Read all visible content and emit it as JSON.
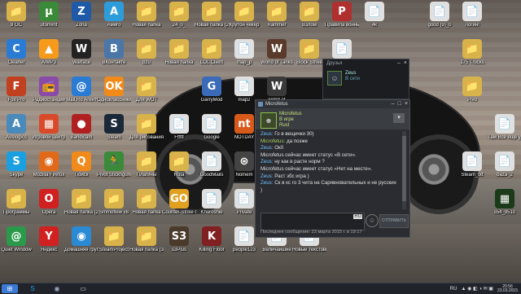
{
  "desktop_icons": [
    {
      "label": "8 ОС",
      "glyph": "📁",
      "color": "#d8b24a",
      "pos": "0,0"
    },
    {
      "label": "utorrent",
      "glyph": "µ",
      "color": "#3a8a3a",
      "pos": "1,0"
    },
    {
      "label": "Zona",
      "glyph": "Z",
      "color": "#1e5aa8",
      "pos": "2,0"
    },
    {
      "label": "Амиго",
      "glyph": "A",
      "color": "#2d9cdb",
      "pos": "3,0"
    },
    {
      "label": "Новая папка",
      "glyph": "📁",
      "color": "#d8b24a",
      "pos": "4,0"
    },
    {
      "label": "24_0_",
      "glyph": "📁",
      "color": "#d8b24a",
      "pos": "5,0"
    },
    {
      "label": "Новая папка (2)",
      "glyph": "📁",
      "color": "#d8b24a",
      "pos": "6,0"
    },
    {
      "label": "Крутой чекер",
      "glyph": "📁",
      "color": "#d8b24a",
      "pos": "7,0"
    },
    {
      "label": "Rammer",
      "glyph": "📁",
      "color": "#d8b24a",
      "pos": "8,0"
    },
    {
      "label": "Взлом",
      "glyph": "📁",
      "color": "#d8b24a",
      "pos": "9,0"
    },
    {
      "label": "Правила войны",
      "glyph": "P",
      "color": "#b03030",
      "pos": "10,0"
    },
    {
      "label": "4k",
      "glyph": "📄",
      "color": "#e0e0e0",
      "pos": "11,0"
    },
    {
      "label": "good (9)_0",
      "glyph": "📄",
      "color": "#e0e0e0",
      "pos": "13,0"
    },
    {
      "label": "Логин!",
      "glyph": "📄",
      "color": "#e0e0e0",
      "pos": "14,0"
    },
    {
      "label": "Cleaner",
      "glyph": "C",
      "color": "#2a7bd4",
      "pos": "0,1"
    },
    {
      "label": "AIMP3",
      "glyph": "▲",
      "color": "#f59a1a",
      "pos": "1,1"
    },
    {
      "label": "Warface",
      "glyph": "W",
      "color": "#222222",
      "pos": "2,1"
    },
    {
      "label": "ВКонтакте",
      "glyph": "В",
      "color": "#4a76a8",
      "pos": "3,1"
    },
    {
      "label": "bzu",
      "glyph": "📁",
      "color": "#d8b24a",
      "pos": "4,1"
    },
    {
      "label": "Новая папка",
      "glyph": "📁",
      "color": "#d8b24a",
      "pos": "5,1"
    },
    {
      "label": "LOL Client",
      "glyph": "📁",
      "color": "#d8b24a",
      "pos": "6,1"
    },
    {
      "label": "map_p",
      "glyph": "📄",
      "color": "#e0e0e0",
      "pos": "7,1"
    },
    {
      "label": "World of Tanks",
      "glyph": "W",
      "color": "#5a3a2a",
      "pos": "8,1"
    },
    {
      "label": "Block Strike",
      "glyph": "📁",
      "color": "#d8b24a",
      "pos": "9,1"
    },
    {
      "label": "good 24",
      "glyph": "📄",
      "color": "#e0e0e0",
      "pos": "10,1"
    },
    {
      "label": "175 Trucks",
      "glyph": "📁",
      "color": "#d8b24a",
      "pos": "14,1"
    },
    {
      "label": "Fox Pro",
      "glyph": "F",
      "color": "#c04020",
      "pos": "0,2"
    },
    {
      "label": "Радиостанции",
      "glyph": "📻",
      "color": "#8a4aa8",
      "pos": "1,2"
    },
    {
      "label": "Mail.Ru Агент",
      "glyph": "@",
      "color": "#2a7bd4",
      "pos": "2,2"
    },
    {
      "label": "Одноклассники",
      "glyph": "OK",
      "color": "#f28a1a",
      "pos": "3,2"
    },
    {
      "label": "Для WOT",
      "glyph": "📁",
      "color": "#d8b24a",
      "pos": "4,2"
    },
    {
      "label": "GarryMod",
      "glyph": "G",
      "color": "#3a6ab8",
      "pos": "6,2"
    },
    {
      "label": "map2",
      "glyph": "📄",
      "color": "#e0e0e0",
      "pos": "7,2"
    },
    {
      "label": "world of",
      "glyph": "W",
      "color": "#3a3a3a",
      "pos": "8,2"
    },
    {
      "label": "Pivo",
      "glyph": "📁",
      "color": "#d8b24a",
      "pos": "14,2"
    },
    {
      "label": "Auslogics",
      "glyph": "A",
      "color": "#4a8aba",
      "pos": "0,3"
    },
    {
      "label": "Игровой центр",
      "glyph": "▦",
      "color": "#d84a2a",
      "pos": "1,3"
    },
    {
      "label": "Bandicam",
      "glyph": "●",
      "color": "#b02020",
      "pos": "2,3"
    },
    {
      "label": "Steam",
      "glyph": "S",
      "color": "#1b2838",
      "pos": "3,3"
    },
    {
      "label": "Для рисования",
      "glyph": "📁",
      "color": "#d8b24a",
      "pos": "4,3"
    },
    {
      "label": "Ffffff",
      "glyph": "📄",
      "color": "#e0e0e0",
      "pos": "5,3"
    },
    {
      "label": "Google",
      "glyph": "📄",
      "color": "#e0e0e0",
      "pos": "6,3"
    },
    {
      "label": "NOTDAY",
      "glyph": "nt",
      "color": "#d85a1a",
      "pos": "7,3"
    },
    {
      "label": "zabugorie",
      "glyph": "📄",
      "color": "#e0e0e0",
      "pos": "8,3"
    },
    {
      "label": "Там Все ещё удалить",
      "glyph": "📄",
      "color": "#e0e0e0",
      "pos": "15,3"
    },
    {
      "label": "Skype",
      "glyph": "S",
      "color": "#1aa0e0",
      "pos": "0,4"
    },
    {
      "label": "Mozilla Firefox",
      "glyph": "◉",
      "color": "#e06a1a",
      "pos": "1,4"
    },
    {
      "label": "Поиск",
      "glyph": "Q",
      "color": "#f08a1a",
      "pos": "2,4"
    },
    {
      "label": "Pivot Stickfigure",
      "glyph": "🏃",
      "color": "#3a8a3a",
      "pos": "3,4"
    },
    {
      "label": "Плагины",
      "glyph": "📁",
      "color": "#d8b24a",
      "pos": "4,4"
    },
    {
      "label": "Rota",
      "glyph": "📁",
      "color": "#d8b24a",
      "pos": "5,4"
    },
    {
      "label": "GoodMails",
      "glyph": "📄",
      "color": "#e0e0e0",
      "pos": "6,4"
    },
    {
      "label": "Nomem",
      "glyph": "⊛",
      "color": "#444444",
      "pos": "7,4"
    },
    {
      "label": "zemutinto",
      "glyph": "📄",
      "color": "#e0e0e0",
      "pos": "8,4"
    },
    {
      "label": "Steam_txt",
      "glyph": "📄",
      "color": "#e0e0e0",
      "pos": "14,4"
    },
    {
      "label": "baza_2",
      "glyph": "📄",
      "color": "#e0e0e0",
      "pos": "15,4"
    },
    {
      "label": "Программы",
      "glyph": "📁",
      "color": "#d8b24a",
      "pos": "0,5"
    },
    {
      "label": "Opera",
      "glyph": "O",
      "color": "#d02020",
      "pos": "1,5"
    },
    {
      "label": "Новая папка (2)",
      "glyph": "📁",
      "color": "#d8b24a",
      "pos": "2,5"
    },
    {
      "label": "Smmoflew v8",
      "glyph": "📁",
      "color": "#d8b24a",
      "pos": "3,5"
    },
    {
      "label": "Новая папка",
      "glyph": "📁",
      "color": "#d8b24a",
      "pos": "4,5"
    },
    {
      "label": "Counter-Strike Global Offensive",
      "glyph": "GO",
      "color": "#e0a020",
      "pos": "5,5"
    },
    {
      "label": "Khoroshie",
      "glyph": "📄",
      "color": "#e0e0e0",
      "pos": "6,5"
    },
    {
      "label": "Private",
      "glyph": "📄",
      "color": "#e0e0e0",
      "pos": "7,5"
    },
    {
      "label": "база wot",
      "glyph": "📄",
      "color": "#e0e0e0",
      "pos": "8,5"
    },
    {
      "label": "s54_9510",
      "glyph": "▦",
      "color": "#1a3a1a",
      "pos": "15,5"
    },
    {
      "label": "Quiet Window",
      "glyph": "@",
      "color": "#2a9a4a",
      "pos": "0,6"
    },
    {
      "label": "Яндекс",
      "glyph": "Y",
      "color": "#d02020",
      "pos": "1,6"
    },
    {
      "label": "Домашняя группа",
      "glyph": "◉",
      "color": "#2a8ad4",
      "pos": "2,6"
    },
    {
      "label": "SteamProject",
      "glyph": "📁",
      "color": "#d8b24a",
      "pos": "3,6"
    },
    {
      "label": "Новая папка (3)",
      "glyph": "📁",
      "color": "#d8b24a",
      "pos": "4,6"
    },
    {
      "label": "s3Plus",
      "glyph": "S3",
      "color": "#4a3a2a",
      "pos": "5,6"
    },
    {
      "label": "Killing Floor",
      "glyph": "K",
      "color": "#802020",
      "pos": "6,6"
    },
    {
      "label": "people123",
      "glyph": "📄",
      "color": "#e0e0e0",
      "pos": "7,6"
    },
    {
      "label": "Величайшие",
      "glyph": "📄",
      "color": "#e0e0e0",
      "pos": "8,6"
    },
    {
      "label": "Новый текстовый",
      "glyph": "📄",
      "color": "#e0e0e0",
      "pos": "9,6"
    }
  ],
  "friends": {
    "title": "Друзья",
    "me_name": "Zeus",
    "me_status": "В сети"
  },
  "chat": {
    "title": "Microfetus",
    "friend_name": "Microfetus",
    "friend_state": "В игре",
    "friend_game": "Rust",
    "messages": [
      {
        "who": "Zeus",
        "text": "Го в вещички 30)",
        "side": "me"
      },
      {
        "who": "Microfetus",
        "text": "да позже",
        "side": "fr"
      },
      {
        "who": "Zeus",
        "text": "Ок0",
        "side": "me"
      },
      {
        "who": "Microfetus",
        "text": "Microfetus сейчас имеет статус «В сети».",
        "side": "sys"
      },
      {
        "who": "Zeus",
        "text": "ну как в расте норм ?",
        "side": "me"
      },
      {
        "who": "Microfetus",
        "text": "Microfetus сейчас имеет статус «Нет на месте».",
        "side": "sys"
      },
      {
        "who": "Zeus",
        "text": "Раст збс игра )",
        "side": "me"
      },
      {
        "who": "Zeus",
        "text": "Ск  в кс го 3 чита на Сарявновательных и не русских )",
        "side": "me"
      }
    ],
    "input_lang": "RU",
    "send_label": "ОТПРАВИТЬ",
    "last_message": "Последнее сообщение: 23 марта 2015 г. в 19:17"
  },
  "taskbar": {
    "lang": "RU",
    "time": "20:56",
    "date": "23.03.2015"
  }
}
